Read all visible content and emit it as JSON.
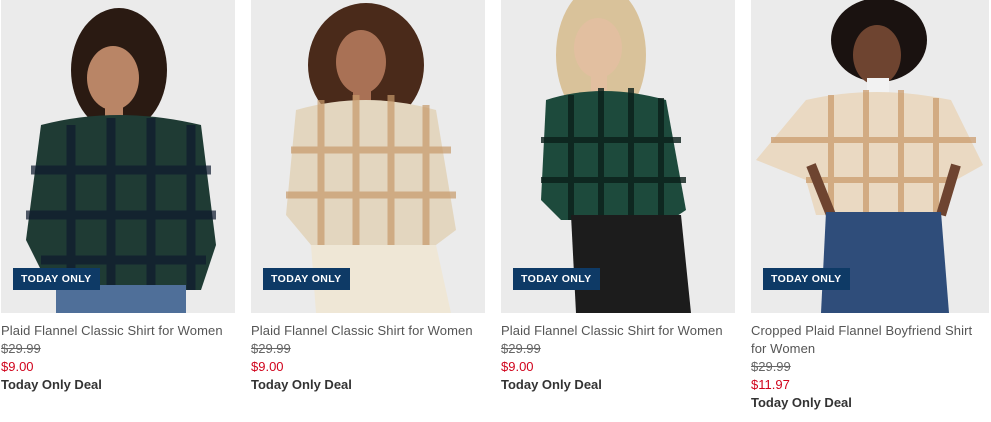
{
  "products": [
    {
      "badge": "TODAY ONLY",
      "title": "Plaid Flannel Classic Shirt for Women",
      "was_price": "$29.99",
      "sale_price": "$9.00",
      "deal": "Today Only Deal",
      "shirt_color": "#1f3b34",
      "plaid_color": "#0e1a2e",
      "skin_color": "#b98566",
      "hair_color": "#2a1a12",
      "bottom_color": "#4f6f99"
    },
    {
      "badge": "TODAY ONLY",
      "title": "Plaid Flannel Classic Shirt for Women",
      "was_price": "$29.99",
      "sale_price": "$9.00",
      "deal": "Today Only Deal",
      "shirt_color": "#e3d6bf",
      "plaid_color": "#c79a6a",
      "skin_color": "#a97155",
      "hair_color": "#4a2a1a",
      "bottom_color": "#efe7d6"
    },
    {
      "badge": "TODAY ONLY",
      "title": "Plaid Flannel Classic Shirt for Women",
      "was_price": "$29.99",
      "sale_price": "$9.00",
      "deal": "Today Only Deal",
      "shirt_color": "#1d4a3c",
      "plaid_color": "#0b1f1a",
      "skin_color": "#e2bfa0",
      "hair_color": "#d9c29a",
      "bottom_color": "#1c1c1c"
    },
    {
      "badge": "TODAY ONLY",
      "title": "Cropped Plaid Flannel Boyfriend Shirt for Women",
      "was_price": "$29.99",
      "sale_price": "$11.97",
      "deal": "Today Only Deal",
      "shirt_color": "#ead9c2",
      "plaid_color": "#c99868",
      "skin_color": "#6e4430",
      "hair_color": "#1a1210",
      "bottom_color": "#2f4d7a"
    }
  ],
  "colors": {
    "badge_bg": "#0e3a66",
    "sale_price": "#d0021b",
    "photo_bg": "#ebebeb"
  }
}
